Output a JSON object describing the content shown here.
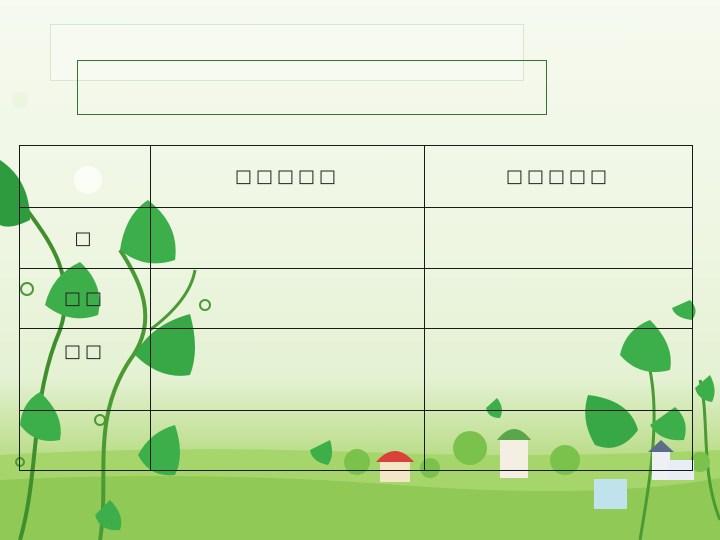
{
  "slide": {
    "title_outer": "",
    "title_inner": ""
  },
  "table": {
    "header": [
      "",
      "□□□□□",
      "□□□□□"
    ],
    "rows": [
      [
        "□",
        "",
        ""
      ],
      [
        "□□",
        "",
        ""
      ],
      [
        "□□",
        "",
        ""
      ],
      [
        "",
        "",
        ""
      ]
    ]
  }
}
